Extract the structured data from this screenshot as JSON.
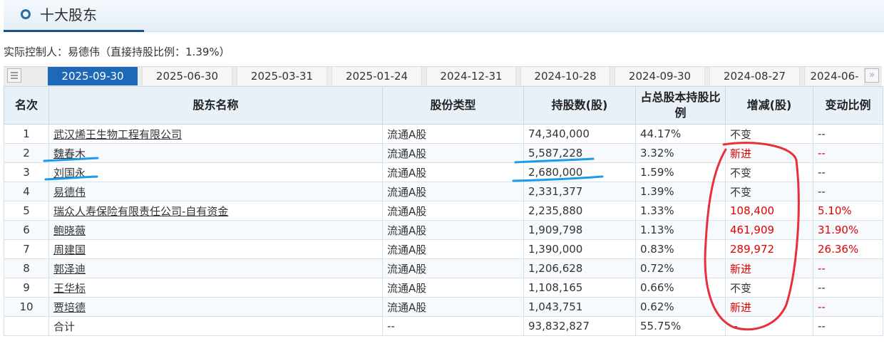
{
  "header": {
    "title": "十大股东"
  },
  "controller_text": "实际控制人：易德伟（直接持股比例：1.39%）",
  "tabs": [
    {
      "label": "2025-09-30",
      "active": true
    },
    {
      "label": "2025-06-30",
      "active": false
    },
    {
      "label": "2025-03-31",
      "active": false
    },
    {
      "label": "2025-01-24",
      "active": false
    },
    {
      "label": "2024-12-31",
      "active": false
    },
    {
      "label": "2024-10-28",
      "active": false
    },
    {
      "label": "2024-09-30",
      "active": false
    },
    {
      "label": "2024-08-27",
      "active": false
    },
    {
      "label": "2024-06-",
      "active": false
    }
  ],
  "icons": {
    "menu": "list-icon",
    "next": "double-chevron-right-icon",
    "header": "circle-icon"
  },
  "colors": {
    "accent": "#1d69b8",
    "increase": "#e00000",
    "annotation_blue": "#1e9be8",
    "annotation_red": "#e8303a"
  },
  "table": {
    "headers": [
      "名次",
      "股东名称",
      "股份类型",
      "持股数(股)",
      "占总股本持股比例",
      "增减(股)",
      "变动比例"
    ],
    "rows": [
      {
        "rank": "1",
        "name": "武汉烯王生物工程有限公司",
        "type": "流通A股",
        "shares": "74,340,000",
        "ratio": "44.17%",
        "change": "不变",
        "change_red": false,
        "pct": "--",
        "pct_red": false
      },
      {
        "rank": "2",
        "name": "魏春木",
        "type": "流通A股",
        "shares": "5,587,228",
        "ratio": "3.32%",
        "change": "新进",
        "change_red": true,
        "pct": "--",
        "pct_red": true
      },
      {
        "rank": "3",
        "name": "刘国永",
        "type": "流通A股",
        "shares": "2,680,000",
        "ratio": "1.59%",
        "change": "不变",
        "change_red": false,
        "pct": "--",
        "pct_red": false
      },
      {
        "rank": "4",
        "name": "易德伟",
        "type": "流通A股",
        "shares": "2,331,377",
        "ratio": "1.39%",
        "change": "不变",
        "change_red": false,
        "pct": "--",
        "pct_red": false
      },
      {
        "rank": "5",
        "name": "瑞众人寿保险有限责任公司-自有资金",
        "type": "流通A股",
        "shares": "2,235,880",
        "ratio": "1.33%",
        "change": "108,400",
        "change_red": true,
        "pct": "5.10%",
        "pct_red": true
      },
      {
        "rank": "6",
        "name": "鲍晓薇",
        "type": "流通A股",
        "shares": "1,909,798",
        "ratio": "1.13%",
        "change": "461,909",
        "change_red": true,
        "pct": "31.90%",
        "pct_red": true
      },
      {
        "rank": "7",
        "name": "周建国",
        "type": "流通A股",
        "shares": "1,390,000",
        "ratio": "0.83%",
        "change": "289,972",
        "change_red": true,
        "pct": "26.36%",
        "pct_red": true
      },
      {
        "rank": "8",
        "name": "郭泽迪",
        "type": "流通A股",
        "shares": "1,206,628",
        "ratio": "0.72%",
        "change": "新进",
        "change_red": true,
        "pct": "--",
        "pct_red": true
      },
      {
        "rank": "9",
        "name": "王华标",
        "type": "流通A股",
        "shares": "1,108,165",
        "ratio": "0.66%",
        "change": "不变",
        "change_red": false,
        "pct": "--",
        "pct_red": false
      },
      {
        "rank": "10",
        "name": "贾培德",
        "type": "流通A股",
        "shares": "1,043,751",
        "ratio": "0.62%",
        "change": "新进",
        "change_red": true,
        "pct": "--",
        "pct_red": true
      }
    ],
    "total": {
      "rank": "",
      "name": "合计",
      "type": "--",
      "shares": "93,832,827",
      "ratio": "55.75%",
      "change": "--",
      "pct": "--"
    }
  }
}
